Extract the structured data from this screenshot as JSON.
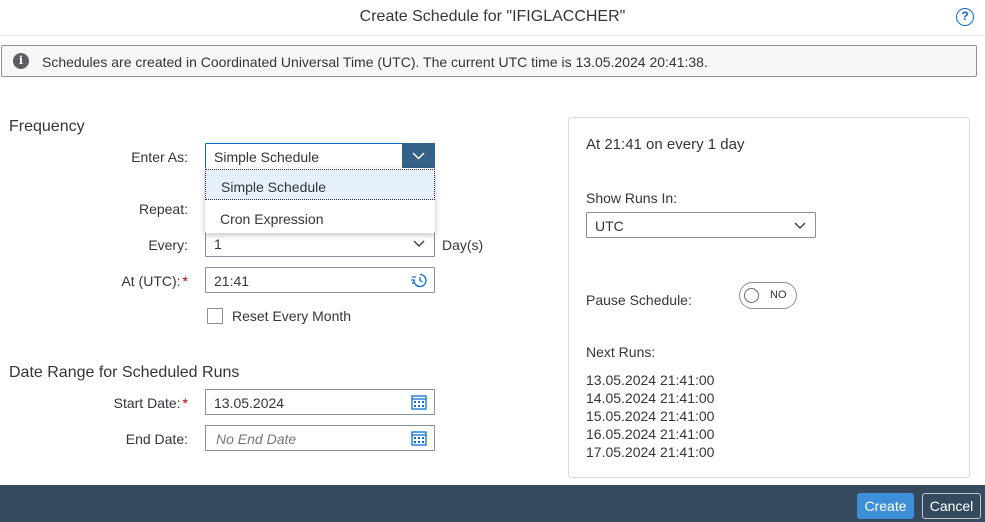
{
  "dialog": {
    "title": "Create Schedule for \"IFIGLACCHER\"",
    "help_icon": "question-circle-icon",
    "help_glyph": "?"
  },
  "info": {
    "icon": "info-icon",
    "icon_glyph": "i",
    "text": "Schedules are created in Coordinated Universal Time (UTC). The current UTC time is 13.05.2024 20:41:38."
  },
  "frequency": {
    "section_title": "Frequency",
    "enter_as_label": "Enter As:",
    "enter_as_value": "Simple Schedule",
    "enter_as_options": [
      "Simple Schedule",
      "Cron Expression"
    ],
    "repeat_label": "Repeat:",
    "every_label": "Every:",
    "every_value": "1",
    "every_unit": "Day(s)",
    "at_label": "At (UTC):",
    "required_mark": "*",
    "at_value": "21:41",
    "reset_month_label": "Reset Every Month",
    "reset_month_checked": false
  },
  "date_range": {
    "section_title": "Date Range for Scheduled Runs",
    "start_label": "Start Date:",
    "start_value": "13.05.2024",
    "end_label": "End Date:",
    "end_placeholder": "No End Date"
  },
  "summary_panel": {
    "summary": "At 21:41 on every 1 day",
    "show_runs_label": "Show Runs In:",
    "show_runs_value": "UTC",
    "pause_label": "Pause Schedule:",
    "pause_state": "NO",
    "next_runs_label": "Next Runs:",
    "next_runs": [
      "13.05.2024 21:41:00",
      "14.05.2024 21:41:00",
      "15.05.2024 21:41:00",
      "16.05.2024 21:41:00",
      "17.05.2024 21:41:00"
    ]
  },
  "footer": {
    "create_label": "Create",
    "cancel_label": "Cancel"
  },
  "colors": {
    "accent": "#0a6ed1",
    "dropdown_arrow_bg": "#346187",
    "required": "#bb0000",
    "footer_bg": "#354a5f",
    "create_btn": "#3c8fd8"
  }
}
